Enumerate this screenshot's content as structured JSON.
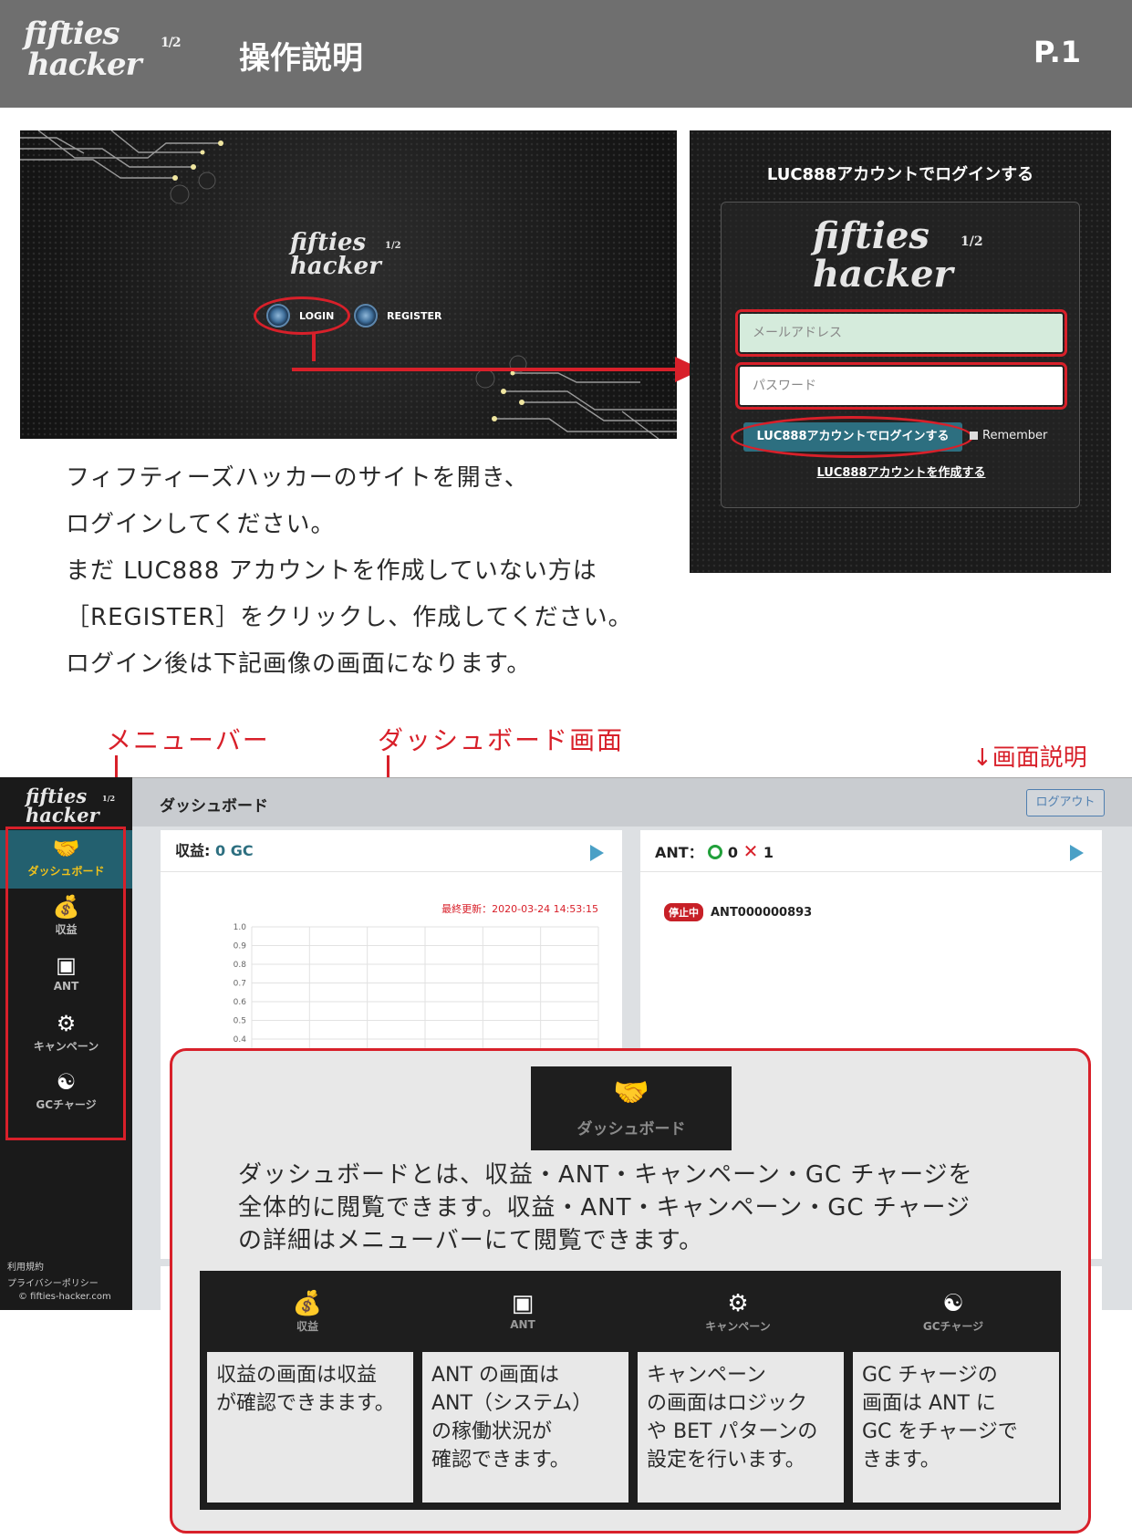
{
  "header": {
    "logo_line1": "fifties",
    "logo_line2": "hacker",
    "logo_half": "1/2",
    "title": "操作説明",
    "page": "P.1"
  },
  "landing": {
    "logo_line1": "fifties",
    "logo_line2": "hacker",
    "logo_half": "1/2",
    "login_label": "LOGIN",
    "register_label": "REGISTER"
  },
  "login_form": {
    "heading": "LUC888アカウントでログインする",
    "logo_line1": "fifties",
    "logo_line2": "hacker",
    "logo_half": "1/2",
    "email_placeholder": "メールアドレス",
    "password_placeholder": "パスワード",
    "submit_label": "LUC888アカウントでログインする",
    "remember_label": "Remember",
    "create_account_link": "LUC888アカウントを作成する"
  },
  "instructions": [
    "フィフティーズハッカーのサイトを開き、",
    "ログインしてください。",
    "まだ LUC888 アカウントを作成していない方は",
    "［REGISTER］をクリックし、作成してください。",
    "ログイン後は下記画像の画面になります。"
  ],
  "labels": {
    "menu_bar": "メニューバー",
    "dashboard_screen": "ダッシュボード画面",
    "screen_explanation": "↓画面説明"
  },
  "dashboard": {
    "sidebar": {
      "logo_line1": "fifties",
      "logo_line2": "hacker",
      "logo_half": "1/2",
      "items": [
        {
          "label": "ダッシュボード",
          "icon": "handshake-icon"
        },
        {
          "label": "収益",
          "icon": "money-bag-icon"
        },
        {
          "label": "ANT",
          "icon": "robot-icon"
        },
        {
          "label": "キャンペーン",
          "icon": "head-gear-icon"
        },
        {
          "label": "GCチャージ",
          "icon": "coin-hand-icon"
        }
      ],
      "footer": [
        "利用規約",
        "プライバシーポリシー",
        "© fifties-hacker.com"
      ]
    },
    "topbar_title": "ダッシュボード",
    "logout_label": "ログアウト",
    "revenue_card": {
      "label": "収益:",
      "value": "0 GC",
      "updated": "最終更新：2020-03-24 14:53:15"
    },
    "ant_card": {
      "label": "ANT：",
      "ok_count": "0",
      "ng_count": "1",
      "status_badge": "停止中",
      "ant_id": "ANT000000893"
    },
    "colors": {
      "sidebar_active": "#23606f",
      "active_text": "#f1c21b",
      "accent_red": "#d8202a",
      "ok_green": "#21a03a"
    }
  },
  "chart_data": {
    "type": "line",
    "title": "",
    "xlabel": "",
    "ylabel": "",
    "ylim": [
      0.4,
      1.0
    ],
    "y_ticks": [
      "1.0",
      "0.9",
      "0.8",
      "0.7",
      "0.6",
      "0.5",
      "0.4"
    ],
    "x": [],
    "series": [],
    "grid": true
  },
  "overlay": {
    "badge_label": "ダッシュボード",
    "explanation": [
      "ダッシュボードとは、収益・ANT・キャンペーン・GC チャージを",
      "全体的に閲覧できます。収益・ANT・キャンペーン・GC チャージ",
      "の詳細はメニューバーにて閲覧できます。"
    ],
    "features": [
      {
        "label": "収益",
        "icon": "money-bag-icon",
        "lines": [
          "収益の画面は収益",
          "が確認できまます。"
        ]
      },
      {
        "label": "ANT",
        "icon": "robot-icon",
        "lines": [
          "ANT の画面は",
          "ANT（システム）",
          "の稼働状況が",
          "確認できます。"
        ]
      },
      {
        "label": "キャンペーン",
        "icon": "head-gear-icon",
        "lines": [
          "キャンペーン",
          "の画面はロジック",
          "や BET パターンの",
          "設定を行います。"
        ]
      },
      {
        "label": "GCチャージ",
        "icon": "coin-hand-icon",
        "lines": [
          "GC チャージの",
          "画面は ANT に",
          "GC をチャージで",
          "きます。"
        ]
      }
    ]
  }
}
